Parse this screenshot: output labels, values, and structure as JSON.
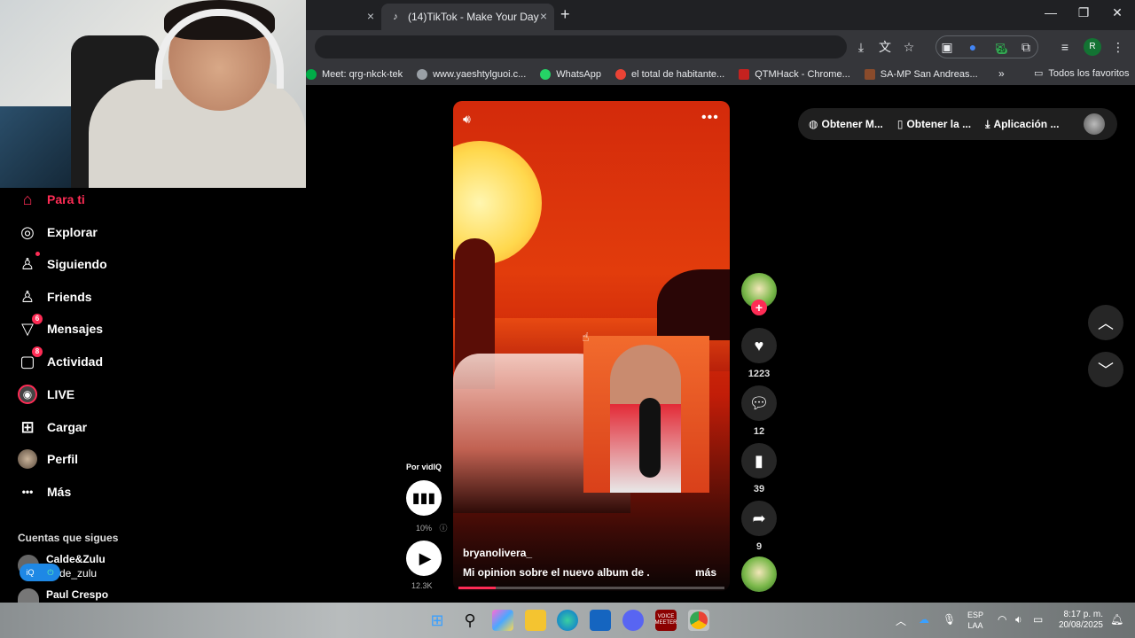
{
  "browser": {
    "active_tab_title": "(14)TikTok - Make Your Day",
    "close_glyph": "×",
    "new_tab_glyph": "+",
    "bookmarks": [
      {
        "label": "Meet: qrg-nkck-tek",
        "color": "#00ac47"
      },
      {
        "label": "www.yaeshtylguoi.c...",
        "color": "#9aa0a6"
      },
      {
        "label": "WhatsApp",
        "color": "#25d366"
      },
      {
        "label": "el total de habitante...",
        "color": "#ea4335"
      },
      {
        "label": "QTMHack - Chrome...",
        "color": "#c5221f"
      },
      {
        "label": "SA-MP San Andreas...",
        "color": "#8a4b2b"
      }
    ],
    "more_bookmarks": "»",
    "all_bookmarks": "Todos los favoritos",
    "profile_initial": "R",
    "extension_badge": "29"
  },
  "sidebar": {
    "items": [
      {
        "label": "Para ti",
        "icon": "home-icon",
        "glyph": "⌂",
        "active": true
      },
      {
        "label": "Explorar",
        "icon": "compass-icon",
        "glyph": "◎"
      },
      {
        "label": "Siguiendo",
        "icon": "following-icon",
        "glyph": "👤"
      },
      {
        "label": "Friends",
        "icon": "friends-icon",
        "glyph": "👥"
      },
      {
        "label": "Mensajes",
        "icon": "messages-icon",
        "glyph": "▽",
        "badge": "6"
      },
      {
        "label": "Actividad",
        "icon": "activity-icon",
        "glyph": "▢",
        "badge": "8"
      },
      {
        "label": "LIVE",
        "icon": "live-icon",
        "glyph": "◉"
      },
      {
        "label": "Cargar",
        "icon": "upload-icon",
        "glyph": "⊞"
      },
      {
        "label": "Perfil",
        "icon": "profile-icon",
        "glyph": "●"
      },
      {
        "label": "Más",
        "icon": "more-icon",
        "glyph": "•••"
      }
    ],
    "following_title": "Cuentas que sigues",
    "accounts": [
      {
        "name": "Calde&Zulu",
        "handle": "de_zulu"
      },
      {
        "name": "Paul Crespo"
      }
    ]
  },
  "video": {
    "username": "bryanolivera_",
    "description": "Mi opinion sobre el nuevo album de ...",
    "more_label": "más",
    "progress": 0.14
  },
  "vidiq": {
    "label": "Por vidIQ",
    "percent": "10%",
    "views": "12.3K"
  },
  "actions": {
    "likes": "1223",
    "comments": "12",
    "saves": "39",
    "shares": "9"
  },
  "top_pill": {
    "items": [
      "Obtener M...",
      "Obtener la ...",
      "Aplicación ..."
    ]
  },
  "taskbar": {
    "lang_top": "ESP",
    "lang_bottom": "LAA",
    "time": "8:17 p. m.",
    "date": "20/08/2025",
    "voicemeeter": "VOICE MEETER"
  }
}
